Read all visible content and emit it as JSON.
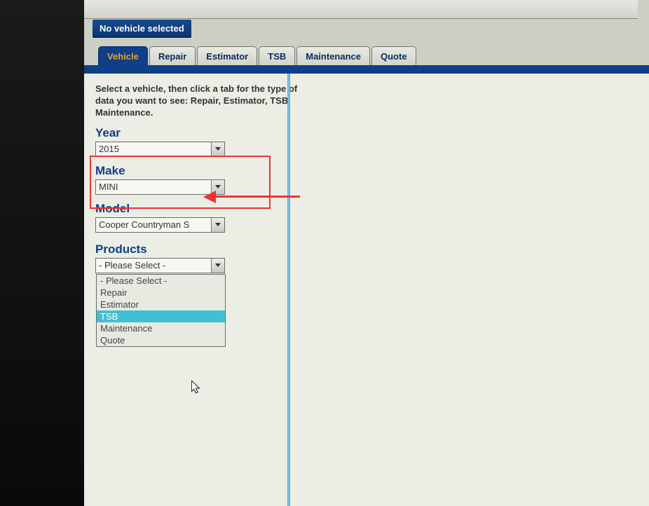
{
  "status": {
    "text": "No vehicle selected"
  },
  "tabs": [
    {
      "label": "Vehicle"
    },
    {
      "label": "Repair"
    },
    {
      "label": "Estimator"
    },
    {
      "label": "TSB"
    },
    {
      "label": "Maintenance"
    },
    {
      "label": "Quote"
    }
  ],
  "instructions": "Select a vehicle, then click a tab for the type of data you want to see: Repair, Estimator, TSB, Maintenance.",
  "fields": {
    "year": {
      "label": "Year",
      "value": "2015"
    },
    "make": {
      "label": "Make",
      "value": "MINI"
    },
    "model": {
      "label": "Model",
      "value": "Cooper Countryman S"
    },
    "products": {
      "label": "Products",
      "value": "- Please Select -",
      "options": [
        "- Please Select -",
        "Repair",
        "Estimator",
        "TSB",
        "Maintenance",
        "Quote"
      ],
      "highlighted": "TSB"
    }
  }
}
